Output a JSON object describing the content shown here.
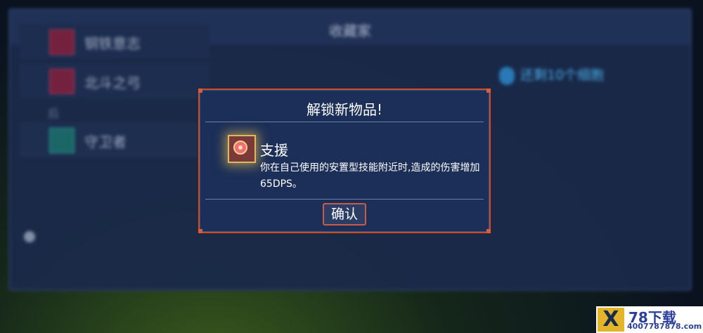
{
  "background": {
    "title": "收藏家",
    "list": [
      {
        "label": "钢铁意志"
      },
      {
        "label": "北斗之弓"
      },
      {
        "label": "守卫者"
      }
    ],
    "subheader": "后",
    "remaining": "还剩10个细胞"
  },
  "dialog": {
    "title": "解锁新物品!",
    "item_name": "支援",
    "item_desc": "你在自己使用的安置型技能附近时,造成的伤害增加65DPS。",
    "item_icon": "support-mutation-icon",
    "confirm_label": "确认"
  },
  "watermark": {
    "logo": "X",
    "name": "78下载",
    "phone": "4007787878.com"
  },
  "colors": {
    "dialog_bg": "#1c2f58",
    "dialog_border": "#b5533d",
    "panel_bg": "#1a2a4a",
    "text": "#ffffff",
    "cell_blue": "#4ab2ee"
  }
}
